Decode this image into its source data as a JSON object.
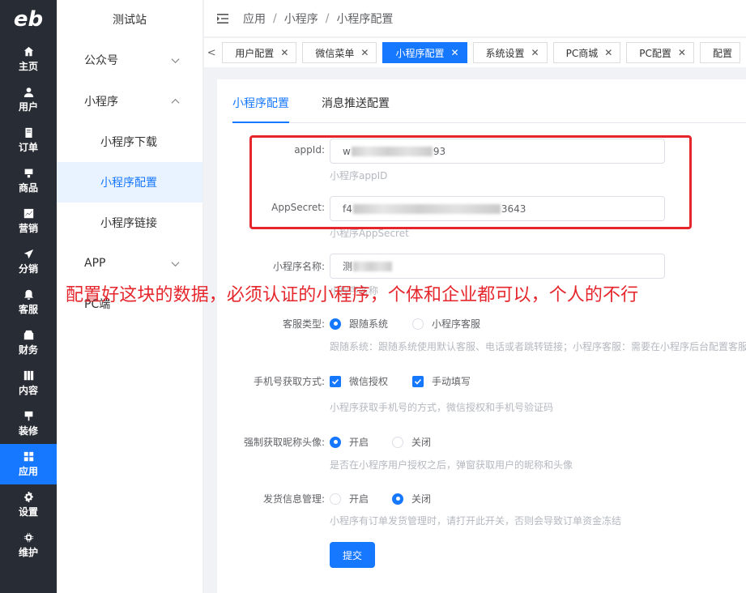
{
  "app": {
    "logo_text": "eb",
    "site_name": "测试站"
  },
  "rail": [
    {
      "label": "主页",
      "icon": "home-icon"
    },
    {
      "label": "用户",
      "icon": "user-icon"
    },
    {
      "label": "订单",
      "icon": "order-icon"
    },
    {
      "label": "商品",
      "icon": "goods-icon"
    },
    {
      "label": "营销",
      "icon": "marketing-icon"
    },
    {
      "label": "分销",
      "icon": "send-icon"
    },
    {
      "label": "客服",
      "icon": "bell-icon"
    },
    {
      "label": "财务",
      "icon": "finance-icon"
    },
    {
      "label": "内容",
      "icon": "content-icon"
    },
    {
      "label": "装修",
      "icon": "brush-icon"
    },
    {
      "label": "应用",
      "icon": "grid-icon",
      "active": true
    },
    {
      "label": "设置",
      "icon": "gear-icon"
    },
    {
      "label": "维护",
      "icon": "chip-icon"
    }
  ],
  "submenu": {
    "group_wechat": "公众号",
    "group_miniprogram": "小程序",
    "item_download": "小程序下载",
    "item_config": "小程序配置",
    "item_link": "小程序链接",
    "group_app": "APP",
    "group_pc": "PC端"
  },
  "breadcrumb": {
    "b1": "应用",
    "sep": "/",
    "b2": "小程序",
    "b3": "小程序配置"
  },
  "tags": {
    "prev": "<",
    "t1": "用户配置",
    "t2": "微信菜单",
    "t3": "小程序配置",
    "t4": "系统设置",
    "t5": "PC商城",
    "t6": "PC配置",
    "t7": "配置",
    "close": "✕"
  },
  "tabs": {
    "tab1": "小程序配置",
    "tab2": "消息推送配置"
  },
  "form": {
    "appid_label": "appId:",
    "appid_prefix": "w",
    "appid_suffix": "93",
    "appid_hint": "小程序appID",
    "secret_label": "AppSecret:",
    "secret_prefix": "f4",
    "secret_suffix": "3643",
    "secret_hint": "小程序AppSecret",
    "name_label": "小程序名称:",
    "name_prefix": "测",
    "name_hint": "小程序名称",
    "service_label": "客服类型:",
    "service_opt1": "跟随系统",
    "service_opt2": "小程序客服",
    "service_hint": "跟随系统：跟随系统使用默认客服、电话或者跳转链接；小程序客服：需要在小程序后台配置客服",
    "phone_label": "手机号获取方式:",
    "phone_opt1": "微信授权",
    "phone_opt2": "手动填写",
    "phone_hint": "小程序获取手机号的方式，微信授权和手机号验证码",
    "avatar_label": "强制获取昵称头像:",
    "avatar_opt1": "开启",
    "avatar_opt2": "关闭",
    "avatar_hint": "是否在小程序用户授权之后，弹窗获取用户的昵称和头像",
    "ship_label": "发货信息管理:",
    "ship_opt1": "开启",
    "ship_opt2": "关闭",
    "ship_hint": "小程序有订单发货管理时，请打开此开关，否则会导致订单资金冻结",
    "submit": "提交"
  },
  "annotation": {
    "text": "配置好这块的数据，必须认证的小程序，个体和企业都可以，个人的不行"
  },
  "colors": {
    "primary": "#1677ff",
    "rail_bg": "#282c34",
    "annotation_red": "#e5262c"
  }
}
